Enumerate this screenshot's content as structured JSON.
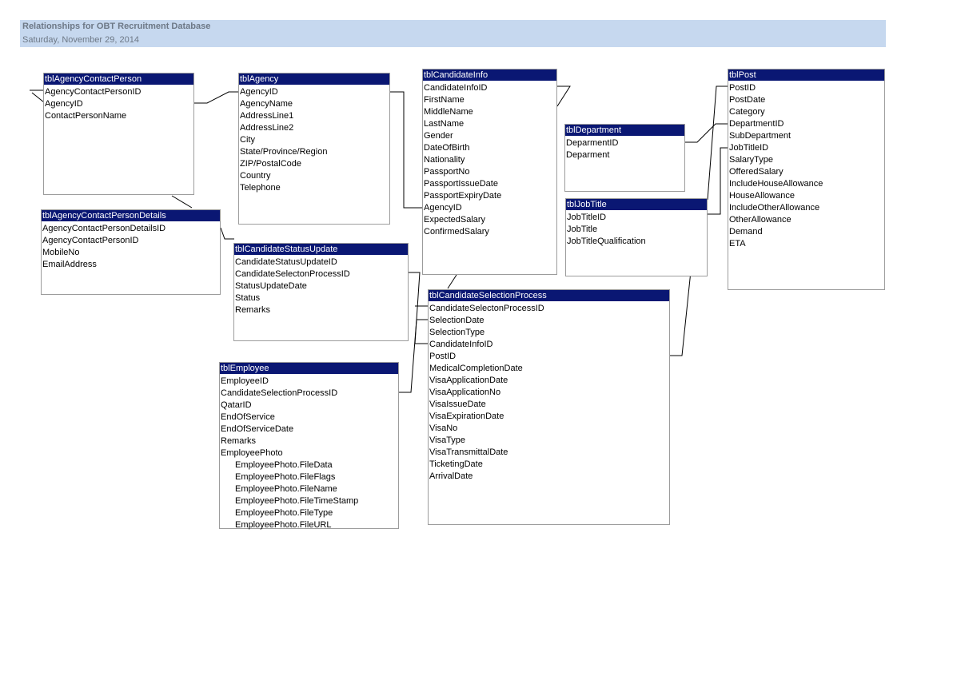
{
  "report": {
    "title": "Relationships for OBT Recruitment Database",
    "date": "Saturday, November 29, 2014"
  },
  "tables": [
    {
      "id": "tblAgencyContactPerson",
      "name": "tblAgencyContactPerson",
      "fields": [
        {
          "name": "AgencyContactPersonID"
        },
        {
          "name": "AgencyID"
        },
        {
          "name": "ContactPersonName"
        }
      ]
    },
    {
      "id": "tblAgency",
      "name": "tblAgency",
      "fields": [
        {
          "name": "AgencyID"
        },
        {
          "name": "AgencyName"
        },
        {
          "name": "AddressLine1"
        },
        {
          "name": "AddressLine2"
        },
        {
          "name": "City"
        },
        {
          "name": "State/Province/Region"
        },
        {
          "name": "ZIP/PostalCode"
        },
        {
          "name": "Country"
        },
        {
          "name": "Telephone"
        }
      ]
    },
    {
      "id": "tblCandidateInfo",
      "name": "tblCandidateInfo",
      "fields": [
        {
          "name": "CandidateInfoID"
        },
        {
          "name": "FirstName"
        },
        {
          "name": "MiddleName"
        },
        {
          "name": "LastName"
        },
        {
          "name": "Gender"
        },
        {
          "name": "DateOfBirth"
        },
        {
          "name": "Nationality"
        },
        {
          "name": "PassportNo"
        },
        {
          "name": "PassportIssueDate"
        },
        {
          "name": "PassportExpiryDate"
        },
        {
          "name": "AgencyID"
        },
        {
          "name": "ExpectedSalary"
        },
        {
          "name": "ConfirmedSalary"
        }
      ]
    },
    {
      "id": "tblDepartment",
      "name": "tblDepartment",
      "fields": [
        {
          "name": "DeparmentID"
        },
        {
          "name": "Deparment"
        }
      ]
    },
    {
      "id": "tblPost",
      "name": "tblPost",
      "fields": [
        {
          "name": "PostID"
        },
        {
          "name": "PostDate"
        },
        {
          "name": "Category"
        },
        {
          "name": "DepartmentID"
        },
        {
          "name": "SubDepartment"
        },
        {
          "name": "JobTitleID"
        },
        {
          "name": "SalaryType"
        },
        {
          "name": "OfferedSalary"
        },
        {
          "name": "IncludeHouseAllowance"
        },
        {
          "name": "HouseAllowance"
        },
        {
          "name": "IncludeOtherAllowance"
        },
        {
          "name": "OtherAllowance"
        },
        {
          "name": "Demand"
        },
        {
          "name": "ETA"
        }
      ]
    },
    {
      "id": "tblJobTitle",
      "name": "tblJobTitle",
      "fields": [
        {
          "name": "JobTitleID"
        },
        {
          "name": "JobTitle"
        },
        {
          "name": "JobTitleQualification"
        }
      ]
    },
    {
      "id": "tblAgencyContactPersonDetails",
      "name": "tblAgencyContactPersonDetails",
      "fields": [
        {
          "name": "AgencyContactPersonDetailsID"
        },
        {
          "name": "AgencyContactPersonID"
        },
        {
          "name": "MobileNo"
        },
        {
          "name": "EmailAddress"
        }
      ]
    },
    {
      "id": "tblCandidateStatusUpdate",
      "name": "tblCandidateStatusUpdate",
      "fields": [
        {
          "name": "CandidateStatusUpdateID"
        },
        {
          "name": "CandidateSelectonProcessID"
        },
        {
          "name": "StatusUpdateDate"
        },
        {
          "name": "Status"
        },
        {
          "name": "Remarks"
        }
      ]
    },
    {
      "id": "tblCandidateSelectionProcess",
      "name": "tblCandidateSelectionProcess",
      "fields": [
        {
          "name": "CandidateSelectonProcessID"
        },
        {
          "name": "SelectionDate"
        },
        {
          "name": "SelectionType"
        },
        {
          "name": "CandidateInfoID"
        },
        {
          "name": "PostID"
        },
        {
          "name": "MedicalCompletionDate"
        },
        {
          "name": "VisaApplicationDate"
        },
        {
          "name": "VisaApplicationNo"
        },
        {
          "name": "VisaIssueDate"
        },
        {
          "name": "VisaExpirationDate"
        },
        {
          "name": "VisaNo"
        },
        {
          "name": "VisaType"
        },
        {
          "name": "VisaTransmittalDate"
        },
        {
          "name": "TicketingDate"
        },
        {
          "name": "ArrivalDate"
        }
      ]
    },
    {
      "id": "tblEmployee",
      "name": "tblEmployee",
      "fields": [
        {
          "name": "EmployeeID"
        },
        {
          "name": "CandidateSelectionProcessID"
        },
        {
          "name": "QatarID"
        },
        {
          "name": "EndOfService"
        },
        {
          "name": "EndOfServiceDate"
        },
        {
          "name": "Remarks"
        },
        {
          "name": "EmployeePhoto"
        },
        {
          "name": "EmployeePhoto.FileData",
          "sub": true
        },
        {
          "name": "EmployeePhoto.FileFlags",
          "sub": true
        },
        {
          "name": "EmployeePhoto.FileName",
          "sub": true
        },
        {
          "name": "EmployeePhoto.FileTimeStamp",
          "sub": true
        },
        {
          "name": "EmployeePhoto.FileType",
          "sub": true
        },
        {
          "name": "EmployeePhoto.FileURL",
          "sub": true
        }
      ]
    }
  ],
  "colors": {
    "header_bg": "#0a1773",
    "header_text": "#ffffff",
    "banner_bg": "#c6d8ef",
    "banner_text": "#6d7886",
    "border": "#9c9c9c",
    "line": "#000000"
  }
}
